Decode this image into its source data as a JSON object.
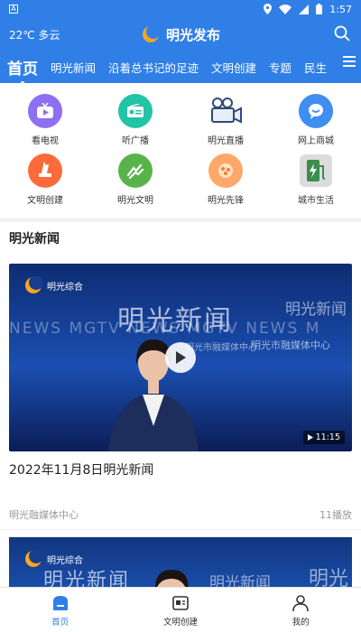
{
  "status_bar": {
    "left_badge": "A",
    "time": "1:57"
  },
  "header": {
    "weather": "22℃ 多云",
    "brand": "明光发布"
  },
  "tabs": [
    {
      "label": "首页",
      "active": true
    },
    {
      "label": "明光新闻"
    },
    {
      "label": "沿着总书记的足迹"
    },
    {
      "label": "文明创建"
    },
    {
      "label": "专题"
    },
    {
      "label": "民生"
    }
  ],
  "shortcuts": [
    {
      "label": "看电视",
      "icon": "tv-icon",
      "color": "#8e6ff2"
    },
    {
      "label": "听广播",
      "icon": "radio-icon",
      "color": "#23c3a6"
    },
    {
      "label": "明光直播",
      "icon": "video-camera-icon",
      "color": "#2f6fd6"
    },
    {
      "label": "网上商城",
      "icon": "shop-chat-icon",
      "color": "#3f8ef0"
    },
    {
      "label": "文明创建",
      "icon": "civilization-icon",
      "color": "#ff6a3a"
    },
    {
      "label": "明光文明",
      "icon": "hands-icon",
      "color": "#58b44a"
    },
    {
      "label": "明光先锋",
      "icon": "pioneer-icon",
      "color": "#ffa86a"
    },
    {
      "label": "城市生活",
      "icon": "ev-charging-icon",
      "color": "#3c8d4f"
    }
  ],
  "news": {
    "section_title": "明光新闻",
    "items": [
      {
        "logo_text": "明光综合",
        "video_title": "明光新闻",
        "video_title_small": "明光新闻",
        "video_en": "NEWS  MGTV NEWS  MGTV NEWS  M",
        "video_sub": "明光市融媒体中心",
        "video_sub2": "明光市融媒体中心",
        "duration": "11:15",
        "title": "2022年11月8日明光新闻",
        "source": "明光融媒体中心",
        "plays": "11播放"
      },
      {
        "logo_text": "明光综合",
        "video_title": "明光新闻",
        "video_title_small": "明光新闻",
        "video_title_right": "明光"
      }
    ]
  },
  "bottom_nav": [
    {
      "label": "首页",
      "icon": "home-icon",
      "active": true
    },
    {
      "label": "文明创建",
      "icon": "news-card-icon"
    },
    {
      "label": "我的",
      "icon": "user-icon"
    }
  ],
  "colors": {
    "primary": "#2f7fe7",
    "accent_logo": "#f5a623"
  }
}
